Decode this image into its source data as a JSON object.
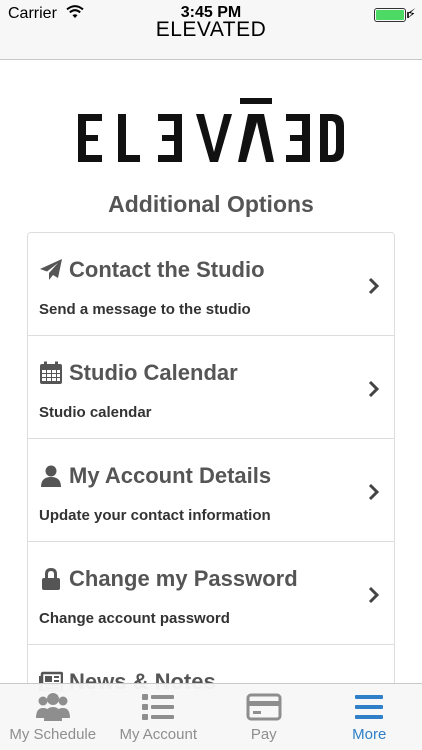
{
  "status": {
    "carrier": "Carrier",
    "time": "3:45 PM"
  },
  "nav": {
    "title": "ELEVATED"
  },
  "logo_text": "ELEVATED",
  "section_title": "Additional Options",
  "items": [
    {
      "title": "Contact the Studio",
      "subtitle": "Send a message to the studio",
      "icon": "paper-plane-icon"
    },
    {
      "title": "Studio Calendar",
      "subtitle": "Studio calendar",
      "icon": "calendar-icon"
    },
    {
      "title": "My Account Details",
      "subtitle": "Update your contact information",
      "icon": "user-icon"
    },
    {
      "title": "Change my Password",
      "subtitle": "Change account password",
      "icon": "lock-icon"
    },
    {
      "title": "News & Notes",
      "subtitle": "",
      "icon": "newspaper-icon"
    }
  ],
  "tabs": [
    {
      "label": "My Schedule",
      "icon": "group-icon",
      "active": false
    },
    {
      "label": "My Account",
      "icon": "list-icon",
      "active": false
    },
    {
      "label": "Pay",
      "icon": "credit-card-icon",
      "active": false
    },
    {
      "label": "More",
      "icon": "menu-icon",
      "active": true
    }
  ],
  "colors": {
    "accent": "#2f80c8",
    "battery": "#4cd964",
    "tab_inactive": "#8e8e8e"
  }
}
